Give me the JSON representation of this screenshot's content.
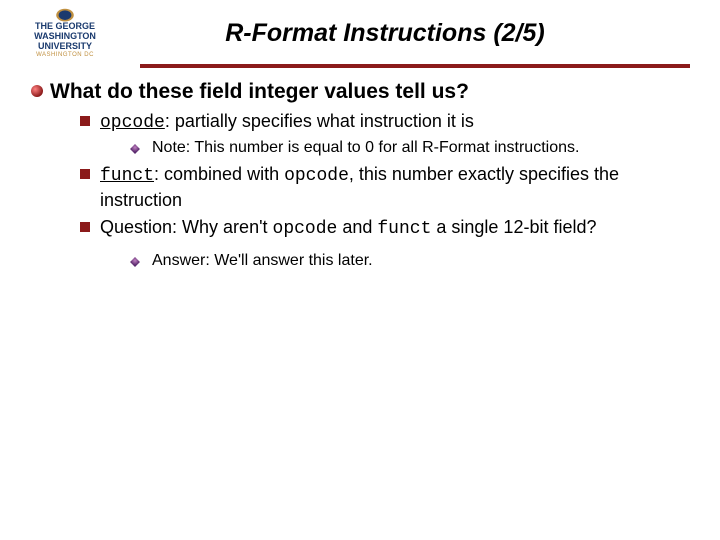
{
  "logo": {
    "line1": "THE",
    "line2": "GEORGE",
    "line3": "WASHINGTON",
    "line4": "UNIVERSITY",
    "sub": "WASHINGTON DC"
  },
  "title": "R-Format Instructions (2/5)",
  "l1_text": "What do these field integer values tell us?",
  "item1": {
    "code": "opcode",
    "rest": ": partially specifies what instruction it is",
    "sub": "Note: This number is equal to 0 for all R-Format instructions."
  },
  "item2": {
    "code": "funct",
    "rest1": ": combined with ",
    "inline_code": "opcode",
    "rest2": ", this number exactly specifies the instruction"
  },
  "item3": {
    "pre": "Question: Why aren't ",
    "code1": "opcode",
    "mid": " and ",
    "code2": "funct",
    "post": " a single 12-bit field?",
    "sub": "Answer: We'll answer this later."
  }
}
